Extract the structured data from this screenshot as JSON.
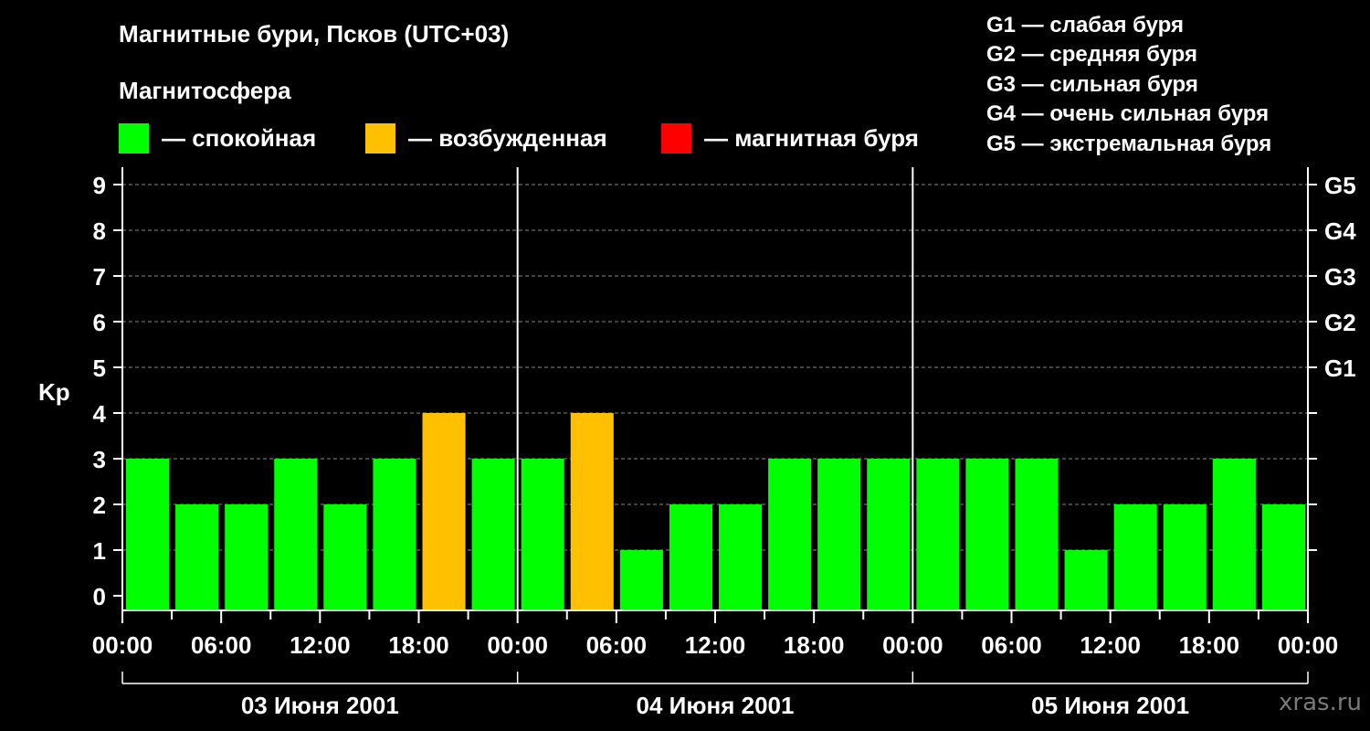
{
  "header": {
    "title": "Магнитные бури, Псков (UTC+03)",
    "subtitle": "Магнитосфера"
  },
  "legend": [
    {
      "label": "— спокойная",
      "color": "#00ff00"
    },
    {
      "label": "— возбужденная",
      "color": "#ffc000"
    },
    {
      "label": "— магнитная буря",
      "color": "#ff0000"
    }
  ],
  "g_legend": [
    "G1 — слабая буря",
    "G2 — средняя буря",
    "G3 — сильная буря",
    "G4 — очень сильная буря",
    "G5 — экстремальная буря"
  ],
  "watermark": "xras.ru",
  "chart_data": {
    "type": "bar",
    "ylabel": "Kp",
    "ylim": [
      0,
      9
    ],
    "yticks": [
      "0",
      "1",
      "2",
      "3",
      "4",
      "5",
      "6",
      "7",
      "8",
      "9"
    ],
    "g_levels": [
      {
        "label": "G1",
        "kp": 5
      },
      {
        "label": "G2",
        "kp": 6
      },
      {
        "label": "G3",
        "kp": 7
      },
      {
        "label": "G4",
        "kp": 8
      },
      {
        "label": "G5",
        "kp": 9
      }
    ],
    "x_tick_labels": [
      "00:00",
      "06:00",
      "12:00",
      "18:00",
      "00:00",
      "06:00",
      "12:00",
      "18:00",
      "00:00",
      "06:00",
      "12:00",
      "18:00",
      "00:00"
    ],
    "days": [
      "03 Июня 2001",
      "04 Июня 2001",
      "05 Июня 2001"
    ],
    "interval_hours": 3,
    "values": [
      3,
      2,
      2,
      3,
      2,
      3,
      4,
      3,
      3,
      4,
      1,
      2,
      2,
      3,
      3,
      3,
      3,
      3,
      3,
      1,
      2,
      2,
      3,
      2
    ],
    "colors": {
      "quiet": "#00ff00",
      "unsettled": "#ffc000",
      "storm": "#ff0000"
    },
    "grid": "dashed horizontal at each Kp",
    "legend_position": "top"
  }
}
